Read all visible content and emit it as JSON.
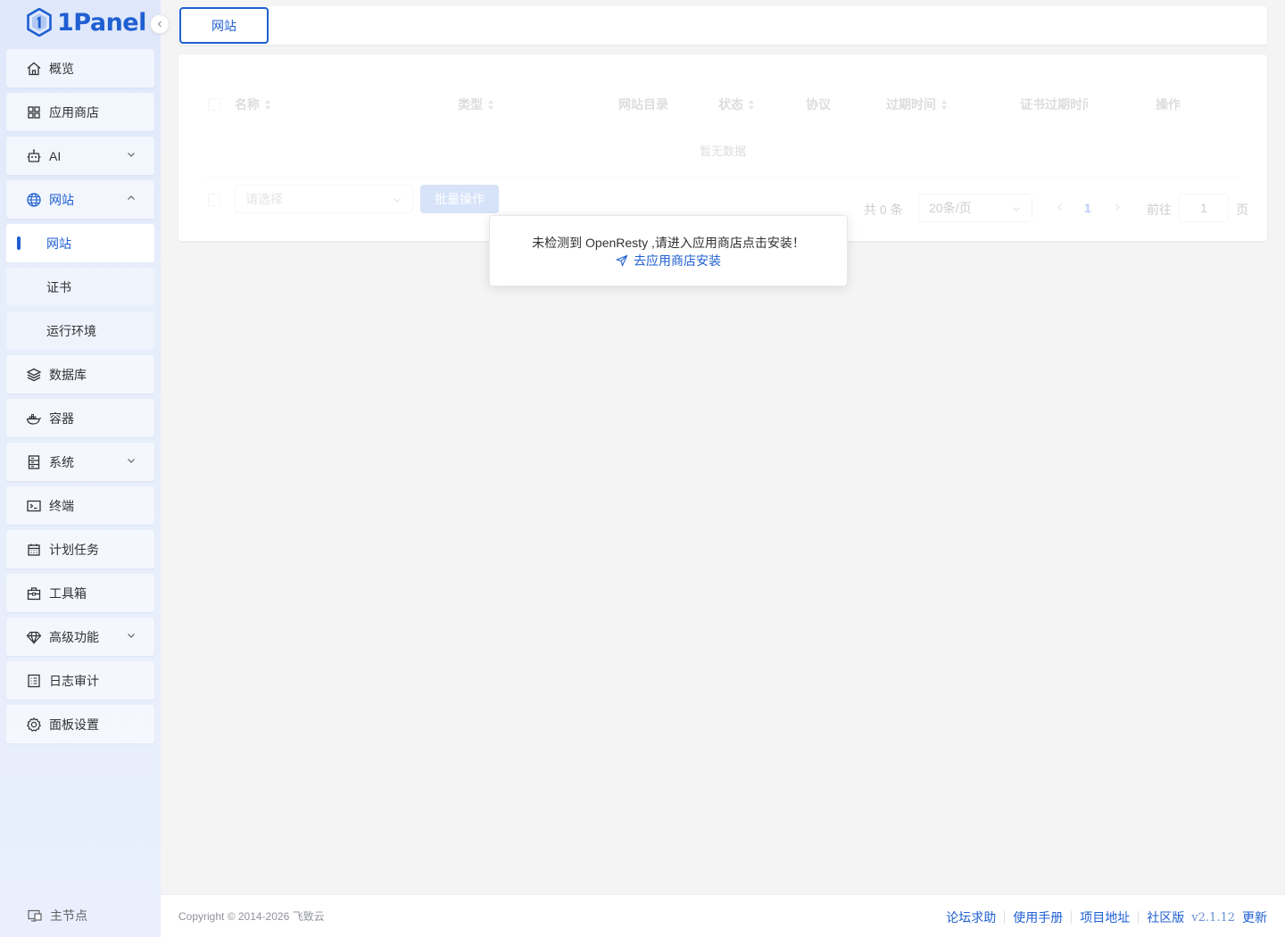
{
  "brand": {
    "name": "1Panel"
  },
  "sidebar": {
    "items": [
      {
        "label": "概览",
        "icon": "home-icon"
      },
      {
        "label": "应用商店",
        "icon": "grid-icon"
      },
      {
        "label": "AI",
        "icon": "robot-icon"
      },
      {
        "label": "网站",
        "icon": "globe-icon"
      },
      {
        "label": "数据库",
        "icon": "layers-icon"
      },
      {
        "label": "容器",
        "icon": "docker-icon"
      },
      {
        "label": "系统",
        "icon": "server-icon"
      },
      {
        "label": "终端",
        "icon": "terminal-icon"
      },
      {
        "label": "计划任务",
        "icon": "calendar-icon"
      },
      {
        "label": "工具箱",
        "icon": "toolbox-icon"
      },
      {
        "label": "高级功能",
        "icon": "diamond-icon"
      },
      {
        "label": "日志审计",
        "icon": "log-icon"
      },
      {
        "label": "面板设置",
        "icon": "settings-icon"
      }
    ],
    "website_sub": [
      "网站",
      "证书",
      "运行环境"
    ],
    "node_label": "主节点"
  },
  "tabs": {
    "active": "网站"
  },
  "table": {
    "columns": [
      "名称",
      "类型",
      "网站目录",
      "状态",
      "协议",
      "过期时间",
      "证书过期时间",
      "操作"
    ],
    "empty_text": "暂无数据",
    "select_placeholder": "请选择",
    "batch_label": "批量操作"
  },
  "pagination": {
    "total_text": "共 0 条",
    "page_size": "20条/页",
    "current_page": "1",
    "goto_label": "前往",
    "goto_value": "1",
    "page_suffix": "页"
  },
  "popover": {
    "message": "未检测到 OpenResty ,请进入应用商店点击安装！",
    "link": "去应用商店安装"
  },
  "footer": {
    "copyright": "Copyright © 2014-2026 飞致云",
    "links": [
      "论坛求助",
      "使用手册",
      "项目地址",
      "社区版"
    ],
    "version": "v2.1.12",
    "update": "更新"
  },
  "colors": {
    "primary": "#1f5fd1",
    "sidebar_bg": "#e6edfb"
  }
}
